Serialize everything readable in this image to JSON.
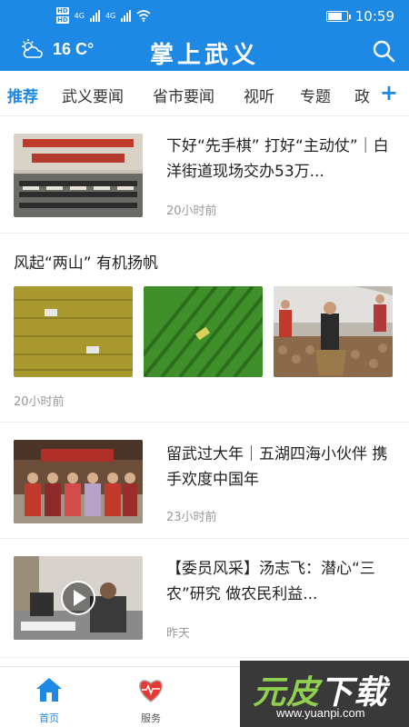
{
  "status_bar": {
    "time": "10:59",
    "hd_top": "HD",
    "hd_bottom": "HD",
    "network1": "4G",
    "network2": "4G"
  },
  "header": {
    "weather_icon": "cloud-sun-icon",
    "temperature": "16 C°",
    "app_title": "掌上武义",
    "search_icon": "search-icon",
    "color": "#1e88e5"
  },
  "tabs": [
    "推荐",
    "武义要闻",
    "省市要闻",
    "视听",
    "专题",
    "政"
  ],
  "tab_add": "+",
  "articles": [
    {
      "title": "下好“先手棋” 打好“主动仗”｜白洋街道现场交办53万...",
      "time": "20小时前"
    },
    {
      "title": "风起“两山” 有机扬帆",
      "time": "20小时前"
    },
    {
      "title": "留武过大年｜五湖四海小伙伴 携手欢度中国年",
      "time": "23小时前"
    },
    {
      "title": "【委员风采】汤志飞：潜心“三农”研究 做农民利益...",
      "time": "昨天"
    }
  ],
  "tabbar": [
    {
      "label": "首页",
      "icon": "home-icon"
    },
    {
      "label": "服务",
      "icon": "heart-icon"
    }
  ],
  "watermark": {
    "logo_green": "元皮",
    "logo_white": "下载",
    "url": "www.yuanpi.com"
  }
}
